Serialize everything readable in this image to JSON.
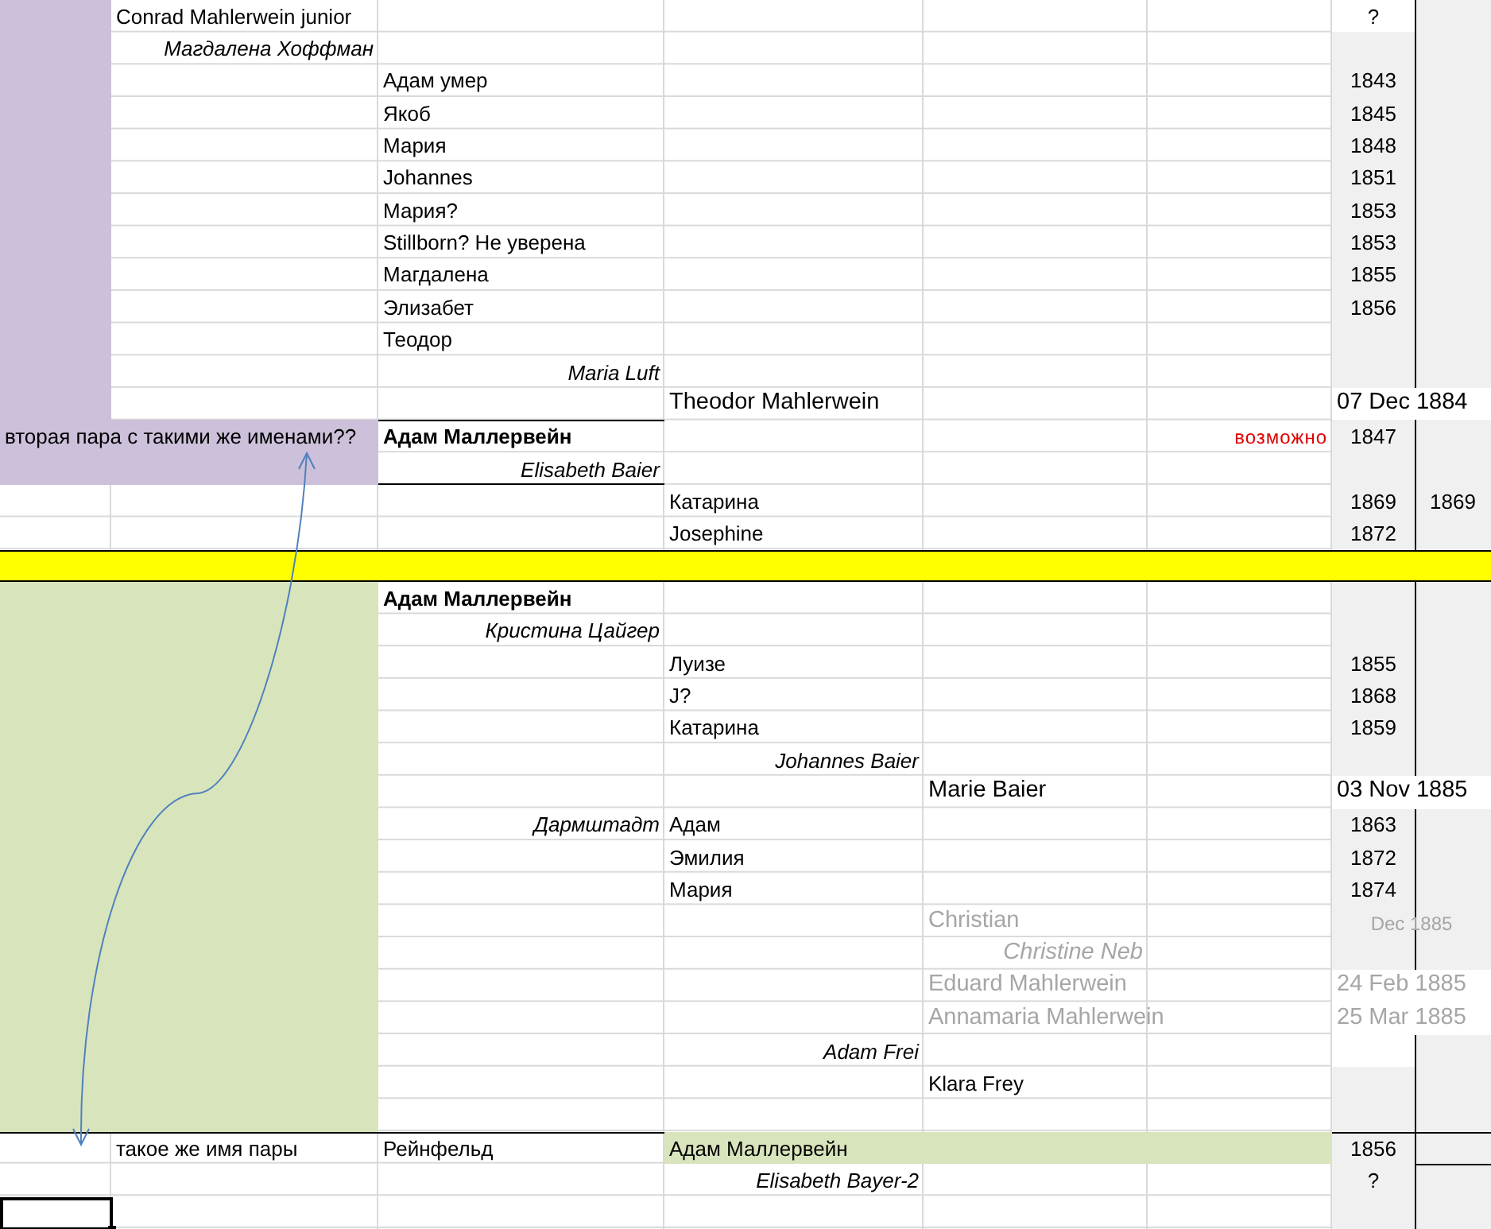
{
  "sections": [
    {
      "color": "#ccc0da",
      "rows": [
        {
          "column_2": {
            "text": "Conrad Mahlerwein junior",
            "kind": "plain"
          },
          "column_7": {
            "text": "?",
            "kind": "year",
            "color": "#ffffff"
          }
        },
        {
          "column_2": {
            "text": "Магдалена Хоффман",
            "kind": "italic"
          }
        },
        {
          "column_3": {
            "text": "Адам  умер",
            "kind": "plain"
          },
          "column_7": {
            "text": "1843",
            "kind": "year"
          }
        },
        {
          "column_3": {
            "text": "Якоб",
            "kind": "plain"
          },
          "column_7": {
            "text": "1845",
            "kind": "year"
          }
        },
        {
          "column_3": {
            "text": "Мария",
            "kind": "plain"
          },
          "column_7": {
            "text": "1848",
            "kind": "year"
          }
        },
        {
          "column_3": {
            "text": "Johannes",
            "kind": "plain"
          },
          "column_7": {
            "text": "1851",
            "kind": "year"
          }
        },
        {
          "column_3": {
            "text": "Мария?",
            "kind": "plain"
          },
          "column_7": {
            "text": "1853",
            "kind": "year"
          }
        },
        {
          "column_3": {
            "text": "Stillborn? Не уверена",
            "kind": "plain"
          },
          "column_7": {
            "text": "1853",
            "kind": "year"
          }
        },
        {
          "column_3": {
            "text": "Магдалена",
            "kind": "plain"
          },
          "column_7": {
            "text": "1855",
            "kind": "year"
          }
        },
        {
          "column_3": {
            "text": "Элизабет",
            "kind": "plain"
          },
          "column_7": {
            "text": "1856",
            "kind": "year"
          }
        },
        {
          "column_3": {
            "text": "Теодор",
            "kind": "plain"
          }
        },
        {
          "column_3": {
            "text": "Maria Luft",
            "kind": "italic"
          }
        },
        {
          "column_4": {
            "text": "Theodor Mahlerwein",
            "kind": "large"
          },
          "column_7": {
            "text": "07 Dec 1884",
            "kind": "date"
          }
        },
        {
          "wide_highlight": true,
          "column_1": {
            "text": "вторая пара с такими же именами??",
            "kind": "plain"
          },
          "column_3": {
            "text": "Адам Маллервейн",
            "kind": "bold",
            "rule_above": true
          },
          "column_6": {
            "text": "возможно",
            "kind": "note"
          },
          "column_7": {
            "text": "1847",
            "kind": "year"
          }
        },
        {
          "wide_highlight": true,
          "column_3": {
            "text": "Elisabeth Baier",
            "kind": "italic",
            "rule_below": true
          }
        }
      ]
    },
    {
      "rows": [
        {
          "column_4": {
            "text": "Катарина",
            "kind": "plain"
          },
          "column_7": {
            "text": "1869",
            "kind": "year"
          },
          "column_8": {
            "text": "1869",
            "kind": "year"
          }
        },
        {
          "column_4": {
            "text": "Josephine",
            "kind": "plain"
          },
          "column_7": {
            "text": "1872",
            "kind": "year"
          }
        }
      ]
    },
    {
      "color": "#ffff00",
      "rows": [
        {}
      ]
    },
    {
      "color": "#d8e4bc",
      "rows": [
        {
          "column_3": {
            "text": "Адам Маллервейн",
            "kind": "bold"
          }
        },
        {
          "column_3": {
            "text": "Кристина Цайгер",
            "kind": "italic"
          }
        },
        {
          "column_4": {
            "text": "Луизе",
            "kind": "plain"
          },
          "column_7": {
            "text": "1855",
            "kind": "year"
          }
        },
        {
          "column_4": {
            "text": "J?",
            "kind": "plain"
          },
          "column_7": {
            "text": "1868",
            "kind": "year"
          }
        },
        {
          "column_4": {
            "text": "Катарина",
            "kind": "plain"
          },
          "column_7": {
            "text": "1859",
            "kind": "year"
          }
        },
        {
          "column_4": {
            "text": "Johannes Baier",
            "kind": "italic"
          }
        },
        {
          "column_5": {
            "text": "Marie Baier",
            "kind": "large"
          },
          "column_7": {
            "text": "03 Nov 1885",
            "kind": "date"
          }
        },
        {
          "column_3": {
            "text": "Дармштадт",
            "kind": "italic"
          },
          "column_4": {
            "text": "Адам",
            "kind": "plain"
          },
          "column_7": {
            "text": "1863",
            "kind": "year"
          }
        },
        {
          "column_4": {
            "text": "Эмилия",
            "kind": "plain"
          },
          "column_7": {
            "text": "1872",
            "kind": "year"
          }
        },
        {
          "column_4": {
            "text": "Мария",
            "kind": "plain"
          },
          "column_7": {
            "text": "1874",
            "kind": "year"
          }
        },
        {
          "column_5": {
            "text": "Christian",
            "kind": "muted"
          },
          "column_7": {
            "text": "Dec 1885",
            "kind": "muted_year"
          }
        },
        {
          "column_5": {
            "text": "Christine Neb",
            "kind": "muted_italic"
          }
        },
        {
          "column_5": {
            "text": "Eduard Mahlerwein",
            "kind": "muted"
          },
          "column_7": {
            "text": "24 Feb 1885",
            "kind": "muted_date"
          }
        },
        {
          "column_5": {
            "text": "Annamaria Mahlerwein",
            "kind": "muted"
          },
          "column_7": {
            "text": "25 Mar 1885",
            "kind": "muted_date"
          }
        },
        {
          "column_4": {
            "text": "Adam Frei",
            "kind": "italic"
          },
          "column_7": {
            "color": "#ffffff"
          }
        },
        {
          "column_5": {
            "text": "Klara Frey",
            "kind": "plain"
          }
        },
        {}
      ]
    },
    {
      "rows": [
        {
          "rule_above": true,
          "column_2": {
            "text": "такое же имя пары",
            "kind": "plain"
          },
          "column_3": {
            "text": "Рейнфельд",
            "kind": "plain"
          },
          "column_4": {
            "text": "Адам Маллервейн",
            "kind": "plain",
            "color": "#d8e4bc"
          },
          "column_5": {
            "color": "#d8e4bc"
          },
          "column_6": {
            "color": "#d8e4bc"
          },
          "column_7": {
            "text": "1856",
            "kind": "year"
          }
        },
        {
          "column_4": {
            "text": "Elisabeth Bayer-2",
            "kind": "italic"
          },
          "column_7": {
            "text": "?",
            "kind": "year"
          },
          "column_8": {
            "rule_above": true
          }
        },
        {
          "column_1": {
            "selected": true
          }
        }
      ]
    }
  ]
}
